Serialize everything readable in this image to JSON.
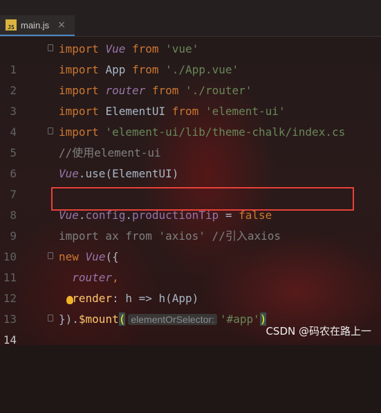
{
  "tab": {
    "icon": "js-file-icon",
    "filename": "main.js",
    "close": "×"
  },
  "lines": [
    {
      "n": "1"
    },
    {
      "n": "2"
    },
    {
      "n": "3"
    },
    {
      "n": "4"
    },
    {
      "n": "5"
    },
    {
      "n": "6"
    },
    {
      "n": "7"
    },
    {
      "n": "8"
    },
    {
      "n": "9"
    },
    {
      "n": "10"
    },
    {
      "n": "11"
    },
    {
      "n": "12"
    },
    {
      "n": "13"
    },
    {
      "n": "14"
    }
  ],
  "code": {
    "l1": {
      "kw": "import",
      "name": "Vue",
      "from": "from",
      "src": "'vue'"
    },
    "l2": {
      "kw": "import",
      "name": "App",
      "from": "from",
      "src": "'./App.vue'"
    },
    "l3": {
      "kw": "import",
      "name": "router",
      "from": "from",
      "src": "'./router'"
    },
    "l4": {
      "kw": "import",
      "name": "ElementUI",
      "from": "from",
      "src": "'element-ui'"
    },
    "l5": {
      "kw": "import",
      "src": "'element-ui/lib/theme-chalk/index.cs"
    },
    "l6": {
      "comment": "//使用element-ui"
    },
    "l7": {
      "obj": "Vue",
      "rest": ".use(ElementUI)"
    },
    "l9": {
      "obj": "Vue",
      "dot1": ".",
      "prop1": "config",
      "dot2": ".",
      "prop2": "productionTip",
      "eq": " = ",
      "val": "false"
    },
    "l10": {
      "text": "import ax from 'axios' //引入axios"
    },
    "l11": {
      "kw": "new",
      "obj": "Vue",
      "rest": "({"
    },
    "l12": {
      "prop": "router",
      "comma": ","
    },
    "l13": {
      "key": "render",
      "rest": ": h => h(App)"
    },
    "l14": {
      "start": "}).",
      "fn": "$mount",
      "paren": "(",
      "hint": "elementOrSelector:",
      "arg": "'#app'",
      "close": ")"
    }
  },
  "watermark": "CSDN @码农在路上一"
}
